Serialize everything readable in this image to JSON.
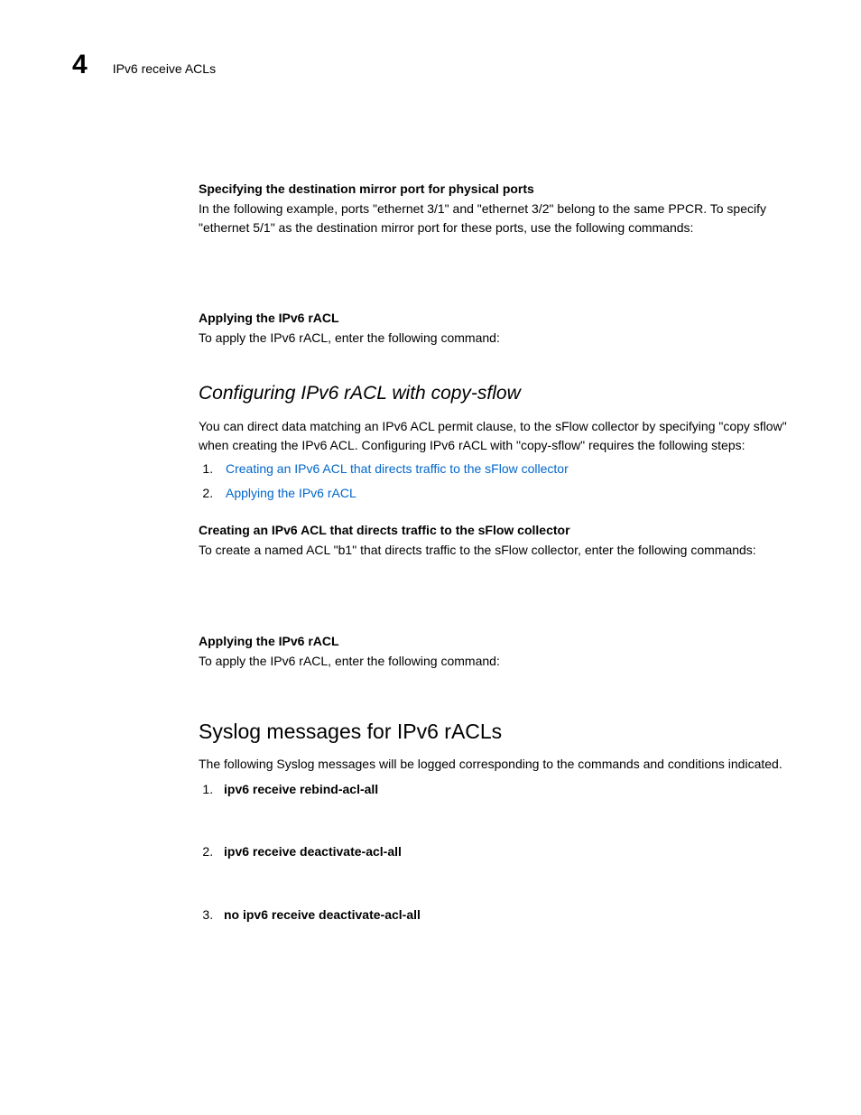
{
  "header": {
    "chapter_number": "4",
    "title": "IPv6 receive ACLs"
  },
  "section1": {
    "heading": "Specifying the destination mirror port for physical ports",
    "body": "In the following example, ports \"ethernet 3/1\" and \"ethernet 3/2\" belong to the same PPCR. To specify \"ethernet 5/1\" as the destination mirror port for these ports, use the following commands:"
  },
  "section2": {
    "heading": "Applying the IPv6 rACL",
    "body": "To apply the IPv6 rACL, enter the following command:"
  },
  "configuring": {
    "title": "Configuring IPv6 rACL with copy-sflow",
    "intro": "You can direct data matching an IPv6 ACL permit clause, to the sFlow collector by specifying \"copy sflow\" when creating the IPv6 ACL. Configuring IPv6 rACL with \"copy-sflow\" requires the following steps:",
    "step1": "Creating an IPv6 ACL that directs traffic to the sFlow collector",
    "step2": "Applying the IPv6 rACL"
  },
  "section3": {
    "heading": "Creating an IPv6 ACL that directs traffic to the sFlow collector",
    "body": "To create a named ACL \"b1\" that directs traffic to the sFlow collector, enter the following commands:"
  },
  "section4": {
    "heading": "Applying the IPv6 rACL",
    "body": "To apply the IPv6 rACL, enter the following command:"
  },
  "syslog": {
    "title": "Syslog messages for IPv6 rACLs",
    "intro": "The following Syslog messages will be logged corresponding to the commands and conditions indicated.",
    "item1": "ipv6 receive rebind-acl-all",
    "item2": "ipv6 receive deactivate-acl-all",
    "item3": "no ipv6 receive deactivate-acl-all"
  }
}
